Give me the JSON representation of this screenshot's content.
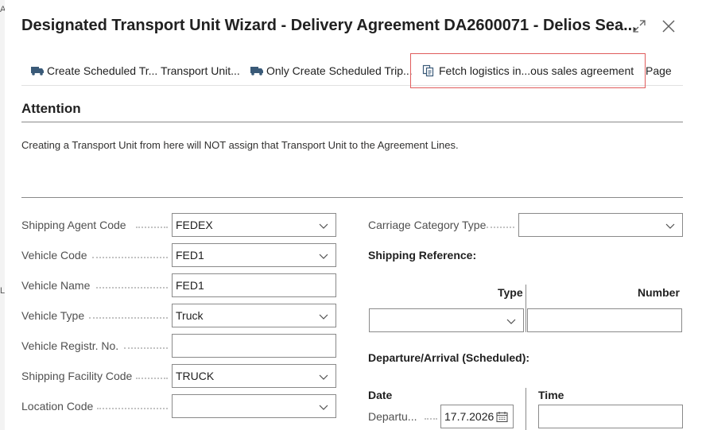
{
  "window": {
    "title": "Designated Transport Unit Wizard - Delivery Agreement DA2600071 - Delios Sea..."
  },
  "actions": [
    {
      "label": "Create Scheduled Tr... Transport Unit..."
    },
    {
      "label": "Only Create Scheduled Trip..."
    },
    {
      "label": "Fetch logistics in...ous sales agreement"
    },
    {
      "label": "Page"
    }
  ],
  "attention": {
    "title": "Attention",
    "message": "Creating a Transport Unit from here will NOT assign that Transport Unit to the Agreement Lines."
  },
  "left_fields": [
    {
      "label": "Shipping Agent Code",
      "value": "FEDEX"
    },
    {
      "label": "Vehicle Code",
      "value": "FED1"
    },
    {
      "label": "Vehicle Name",
      "value": "FED1"
    },
    {
      "label": "Vehicle Type",
      "value": "Truck"
    },
    {
      "label": "Vehicle Registr. No.",
      "value": ""
    },
    {
      "label": "Shipping Facility Code",
      "value": "TRUCK"
    },
    {
      "label": "Location Code",
      "value": ""
    }
  ],
  "right": {
    "carriage_label": "Carriage Category Type",
    "carriage_value": "",
    "shipping_reference_title": "Shipping Reference:",
    "col_type": "Type",
    "col_number": "Number",
    "departure_title": "Departure/Arrival (Scheduled):",
    "col_date": "Date",
    "col_time": "Time",
    "departure_label": "Departu...",
    "departure_date": "17.7.2026"
  },
  "edge_chars": [
    "A",
    "L"
  ]
}
